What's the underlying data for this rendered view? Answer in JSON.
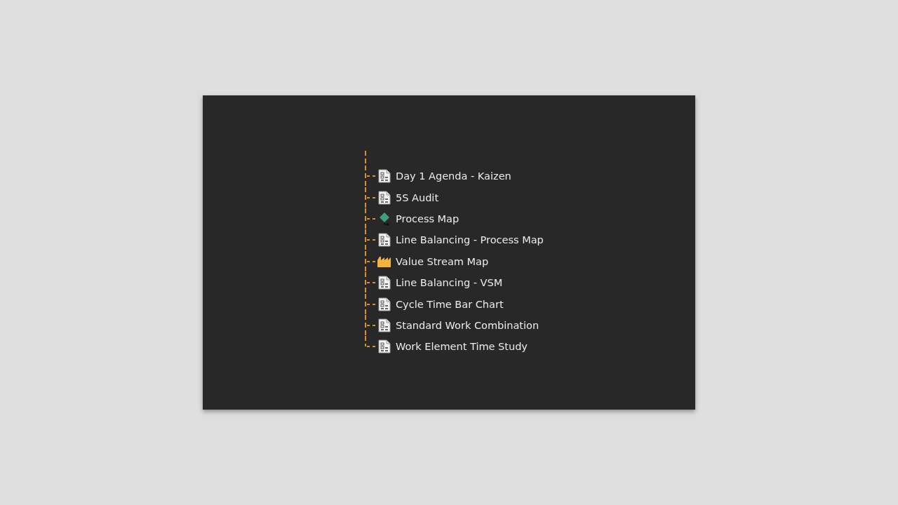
{
  "tree": {
    "items": [
      {
        "label": "Day 1 Agenda - Kaizen",
        "kind": "form"
      },
      {
        "label": "5S Audit",
        "kind": "form"
      },
      {
        "label": "Process Map",
        "kind": "process"
      },
      {
        "label": "Line Balancing - Process Map",
        "kind": "form"
      },
      {
        "label": "Value Stream Map",
        "kind": "vsm"
      },
      {
        "label": "Line Balancing - VSM",
        "kind": "form"
      },
      {
        "label": "Cycle Time Bar Chart",
        "kind": "form"
      },
      {
        "label": "Standard Work Combination",
        "kind": "form"
      },
      {
        "label": "Work Element Time Study",
        "kind": "form"
      }
    ]
  }
}
